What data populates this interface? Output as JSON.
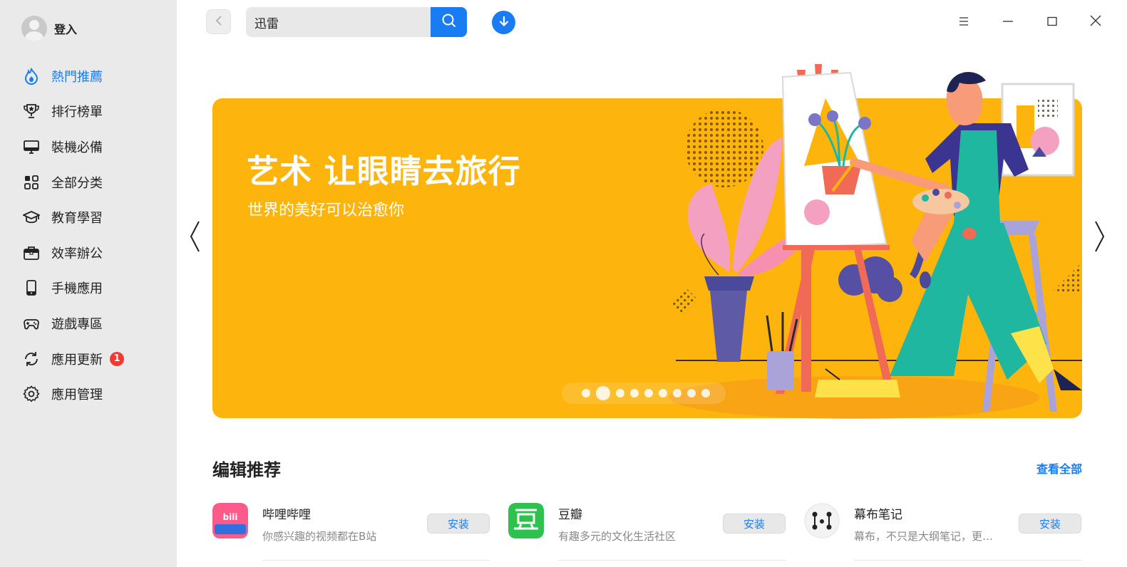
{
  "sidebar": {
    "login_label": "登入",
    "items": [
      {
        "label": "熱門推薦",
        "icon": "flame-icon",
        "active": true
      },
      {
        "label": "排行榜單",
        "icon": "trophy-icon"
      },
      {
        "label": "裝機必備",
        "icon": "monitor-icon"
      },
      {
        "label": "全部分类",
        "icon": "grid-icon"
      },
      {
        "label": "教育學習",
        "icon": "graduation-cap-icon"
      },
      {
        "label": "效率辦公",
        "icon": "briefcase-icon"
      },
      {
        "label": "手機應用",
        "icon": "phone-icon"
      },
      {
        "label": "遊戲專區",
        "icon": "gamepad-icon"
      },
      {
        "label": "應用更新",
        "icon": "refresh-icon",
        "badge": "1"
      },
      {
        "label": "應用管理",
        "icon": "gear-icon"
      }
    ]
  },
  "search": {
    "value": "迅雷"
  },
  "banner": {
    "title": "艺术 让眼睛去旅行",
    "subtitle": "世界的美好可以治愈你",
    "slide_count": 9,
    "active_slide": 2,
    "background_color": "#fdb40c"
  },
  "editor_picks": {
    "title": "编辑推荐",
    "view_all": "查看全部",
    "apps": [
      {
        "name": "哔哩哔哩",
        "desc": "你感兴趣的视频都在B站",
        "install": "安装",
        "icon": "bilibili-icon"
      },
      {
        "name": "豆瓣",
        "desc": "有趣多元的文化生活社区",
        "install": "安装",
        "icon": "douban-icon"
      },
      {
        "name": "幕布笔记",
        "desc": "幕布，不只是大纲笔记，更…",
        "install": "安装",
        "icon": "mubu-icon"
      }
    ]
  },
  "colors": {
    "accent": "#1a7cf3",
    "sidebar_bg": "#eaeaea",
    "badge": "#f23a32"
  }
}
